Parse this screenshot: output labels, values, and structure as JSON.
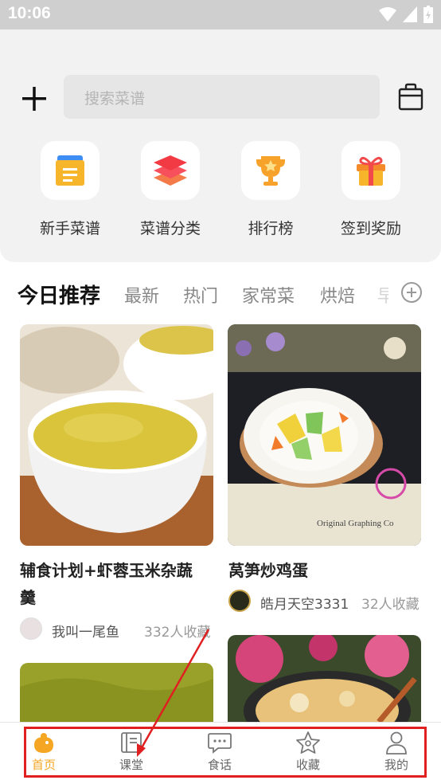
{
  "status": {
    "time": "10:06"
  },
  "search": {
    "placeholder": "搜索菜谱"
  },
  "quick_actions": [
    {
      "label": "新手菜谱",
      "icon": "notebook-icon"
    },
    {
      "label": "菜谱分类",
      "icon": "layers-icon"
    },
    {
      "label": "排行榜",
      "icon": "trophy-icon"
    },
    {
      "label": "签到奖励",
      "icon": "gift-icon"
    }
  ],
  "categories": {
    "active": "今日推荐",
    "items": [
      "最新",
      "热门",
      "家常菜",
      "烘焙",
      "早"
    ]
  },
  "feed": [
    {
      "title_line1": "辅食计划+虾蓉玉米杂蔬",
      "title_line2": "羹",
      "author": "我叫一尾鱼",
      "favorites": "332人收藏"
    },
    {
      "title_line1": "莴笋炒鸡蛋",
      "author": "皓月天空3331",
      "favorites": "32人收藏"
    }
  ],
  "photo_caption": "Original Graphing Co",
  "bottom_nav": [
    {
      "label": "首页",
      "active": true
    },
    {
      "label": "课堂"
    },
    {
      "label": "食话"
    },
    {
      "label": "收藏"
    },
    {
      "label": "我的"
    }
  ],
  "colors": {
    "accent": "#f5a623",
    "annotation": "#e02020"
  }
}
